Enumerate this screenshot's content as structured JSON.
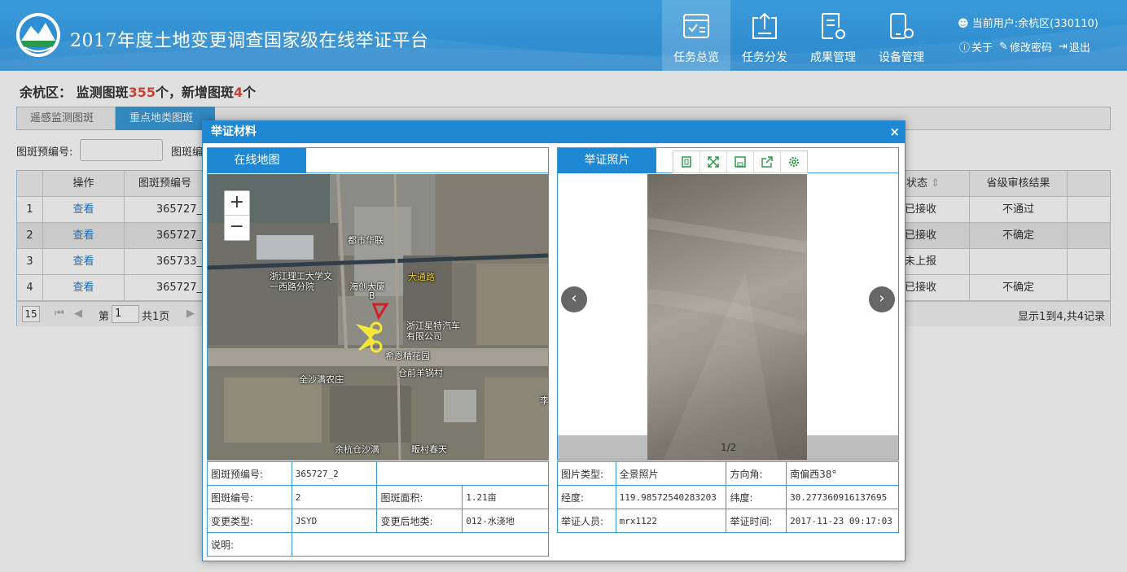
{
  "header": {
    "title": "2017年度土地变更调查国家级在线举证平台",
    "nav": [
      "任务总览",
      "任务分发",
      "成果管理",
      "设备管理"
    ],
    "user": "当前用户:余杭区(330110)",
    "links": [
      "关于",
      "修改密码",
      "退出"
    ]
  },
  "summary": {
    "region": "余杭区：",
    "part1": "监测图斑",
    "count1": "355",
    "part2": "个，新增图斑",
    "count2": "4",
    "part3": "个"
  },
  "tabs": [
    "遥感监测图斑",
    "重点地类图斑"
  ],
  "filters": {
    "label1": "图斑预编号:",
    "label2": "图斑编"
  },
  "grid": {
    "headers": {
      "op": "操作",
      "preid": "图斑预编号",
      "status": "状态",
      "result": "省级审核结果"
    },
    "rows": [
      {
        "n": "1",
        "op": "查看",
        "preid": "365727_",
        "status": "已接收",
        "result": "不通过"
      },
      {
        "n": "2",
        "op": "查看",
        "preid": "365727_",
        "status": "已接收",
        "result": "不确定"
      },
      {
        "n": "3",
        "op": "查看",
        "preid": "365733_",
        "status": "未上报",
        "result": ""
      },
      {
        "n": "4",
        "op": "查看",
        "preid": "365727_",
        "status": "已接收",
        "result": "不确定"
      }
    ],
    "pager": {
      "size": "15",
      "page_pre": "第",
      "page": "1",
      "total": "共1页",
      "summary": "显示1到4,共4记录"
    }
  },
  "modal": {
    "title": "举证材料",
    "close": "×",
    "map_tab": "在线地图",
    "photo_tab": "举证照片",
    "zoom_in": "+",
    "zoom_out": "−",
    "map_labels": [
      "都市华联",
      "浙江理工大学文",
      "一西路分院",
      "海创大厦",
      "B",
      "浙江星特汽车",
      "有限公司",
      "希恩精花园",
      "全沙满农庄",
      "仓前羊锅村",
      "余杭仓沙满",
      "畈村春天",
      "大通路",
      "李"
    ],
    "photo_counter": "1/2",
    "map_info": {
      "preid_label": "图斑预编号:",
      "preid": "365727_2",
      "id_label": "图斑编号:",
      "id": "2",
      "area_label": "图斑面积:",
      "area": "1.21亩",
      "type_label": "变更类型:",
      "type": "JSYD",
      "after_label": "变更后地类:",
      "after": "012-水浇地",
      "desc_label": "说明:",
      "desc": ""
    },
    "photo_info": {
      "ptype_label": "图片类型:",
      "ptype": "全景照片",
      "azimuth_label": "方向角:",
      "azimuth": "南偏西38°",
      "lon_label": "经度:",
      "lon": "119.98572540283203",
      "lat_label": "纬度:",
      "lat": "30.277360916137695",
      "person_label": "举证人员:",
      "person": "mrx1122",
      "time_label": "举证时间:",
      "time": "2017-11-23 09:17:03"
    }
  },
  "colors": {
    "header": "#2c88cc",
    "accent": "#1e88d4",
    "red": "#e74c3c"
  }
}
